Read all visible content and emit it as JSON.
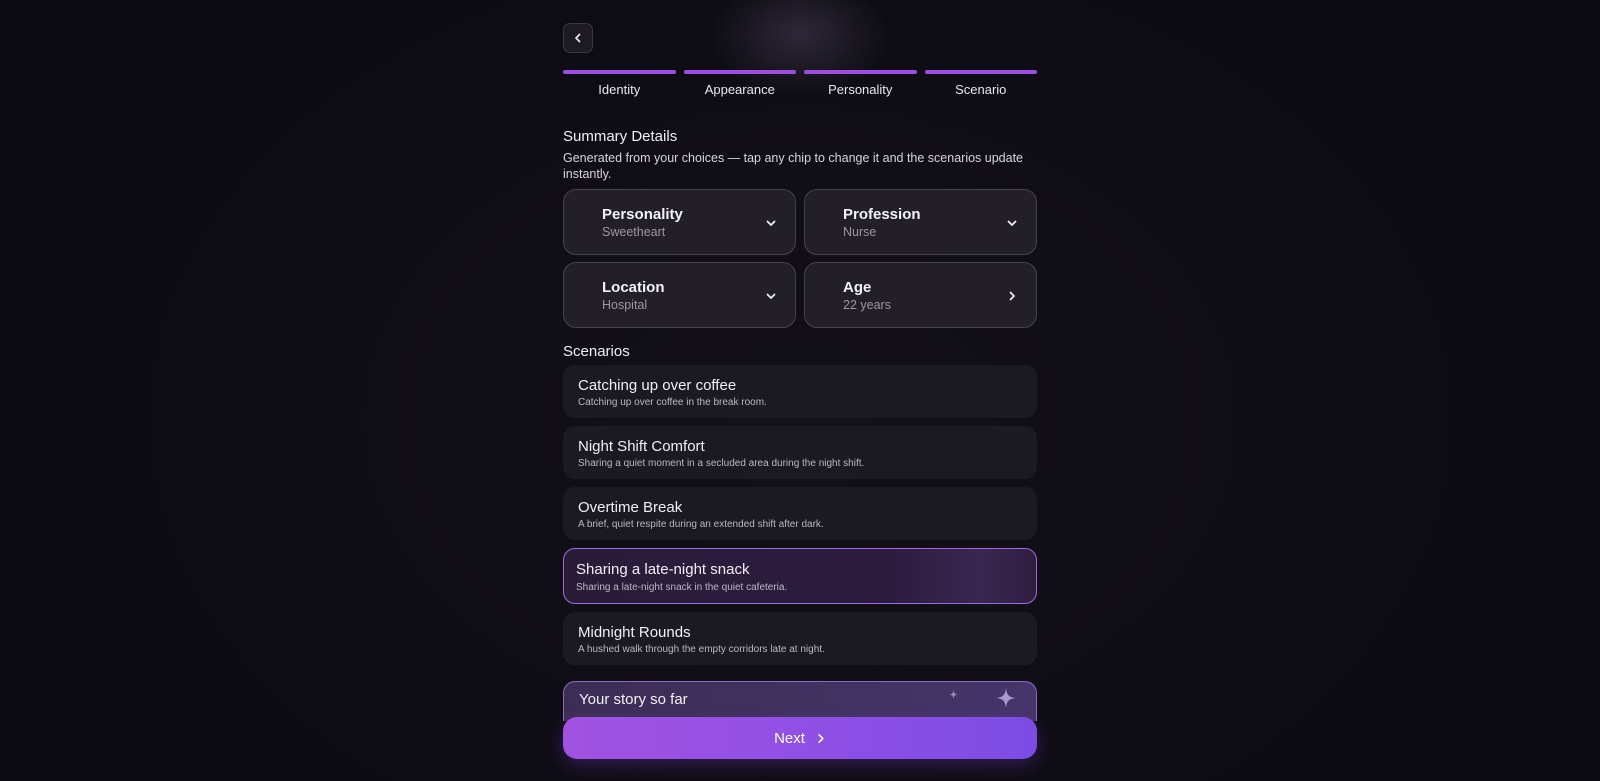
{
  "steps": [
    {
      "label": "Identity"
    },
    {
      "label": "Appearance"
    },
    {
      "label": "Personality"
    },
    {
      "label": "Scenario"
    }
  ],
  "summary": {
    "title": "Summary Details",
    "description": "Generated from your choices — tap any chip to change it and the scenarios update instantly.",
    "chips": [
      {
        "title": "Personality",
        "value": "Sweetheart",
        "icon": "chevron-down-icon"
      },
      {
        "title": "Profession",
        "value": "Nurse",
        "icon": "chevron-down-icon"
      },
      {
        "title": "Location",
        "value": "Hospital",
        "icon": "chevron-down-icon"
      },
      {
        "title": "Age",
        "value": "22 years",
        "icon": "chevron-right-icon"
      }
    ]
  },
  "scenarios": {
    "title": "Scenarios",
    "items": [
      {
        "title": "Catching up over coffee",
        "desc": "Catching up over coffee in the break room."
      },
      {
        "title": "Night Shift Comfort",
        "desc": "Sharing a quiet moment in a secluded area during the night shift."
      },
      {
        "title": "Overtime Break",
        "desc": "A brief, quiet respite during an extended shift after dark."
      },
      {
        "title": "Sharing a late-night snack",
        "desc": "Sharing a late-night snack in the quiet cafeteria.",
        "selected": true
      },
      {
        "title": "Midnight Rounds",
        "desc": "A hushed walk through the empty corridors late at night."
      }
    ]
  },
  "story": {
    "title": "Your story so far"
  },
  "next_button": {
    "label": "Next"
  },
  "colors": {
    "accent": "#9b4fe0",
    "selected_border": "#a36ae0"
  }
}
